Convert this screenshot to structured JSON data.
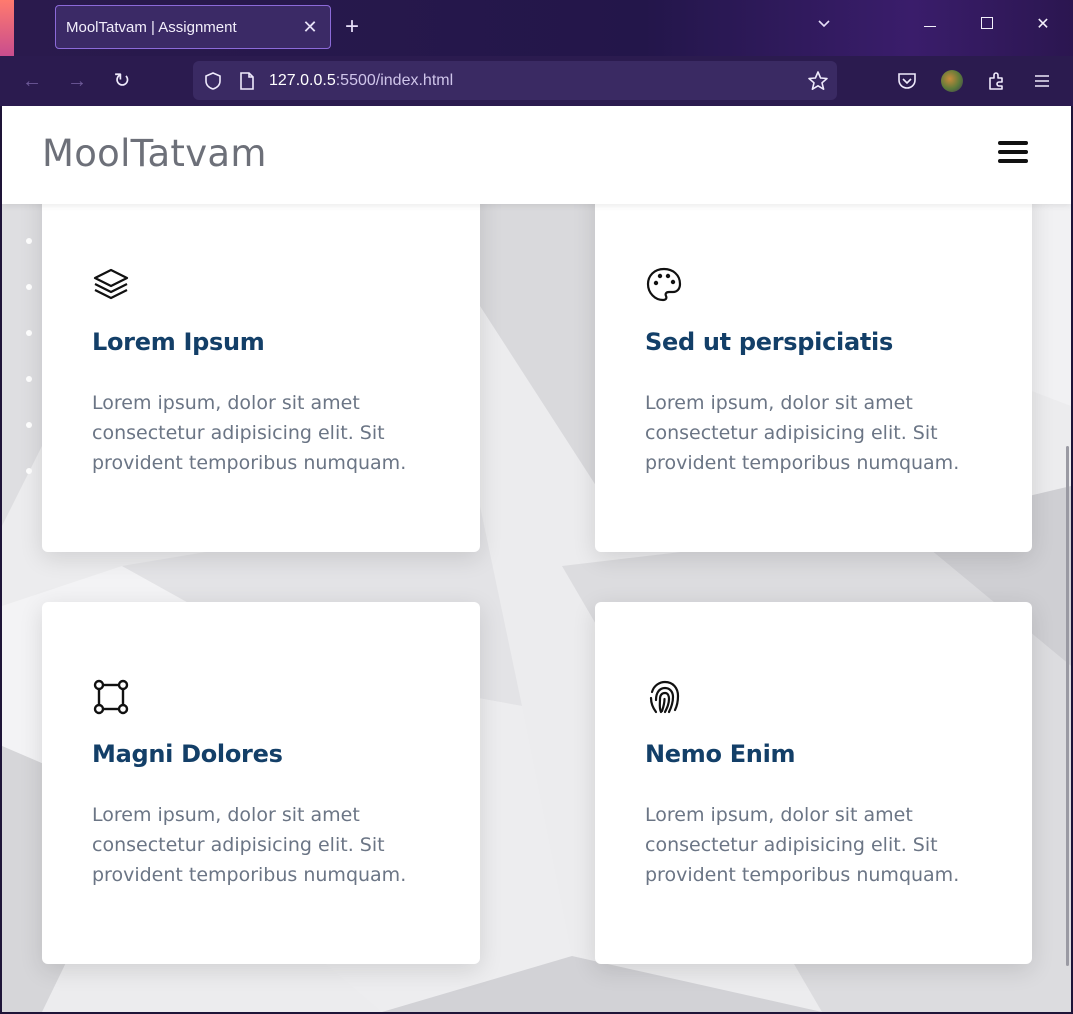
{
  "browser": {
    "tab_title": "MoolTatvam | Assignment",
    "tab_close": "✕",
    "new_tab": "+",
    "list_tabs": "⌄",
    "url_host": "127.0.0.5",
    "url_rest": ":5500/index.html",
    "nav_back": "←",
    "nav_forward": "→",
    "nav_reload": "↻",
    "win_close": "✕"
  },
  "site": {
    "logo": "MoolTatvam"
  },
  "cards": [
    {
      "icon": "layers-icon",
      "title": "Lorem Ipsum",
      "text": "Lorem ipsum, dolor sit amet consectetur adipisicing elit. Sit provident temporibus numquam."
    },
    {
      "icon": "palette-icon",
      "title": "Sed ut perspiciatis",
      "text": "Lorem ipsum, dolor sit amet consectetur adipisicing elit. Sit provident temporibus numquam."
    },
    {
      "icon": "bounding-box-icon",
      "title": "Magni Dolores",
      "text": "Lorem ipsum, dolor sit amet consectetur adipisicing elit. Sit provident temporibus numquam."
    },
    {
      "icon": "fingerprint-icon",
      "title": "Nemo Enim",
      "text": "Lorem ipsum, dolor sit amet consectetur adipisicing elit. Sit provident temporibus numquam."
    }
  ],
  "colors": {
    "title": "#133f68",
    "body_text": "#6b7585",
    "logo": "#6d7079",
    "browser_bg": "#2b1b4f"
  }
}
